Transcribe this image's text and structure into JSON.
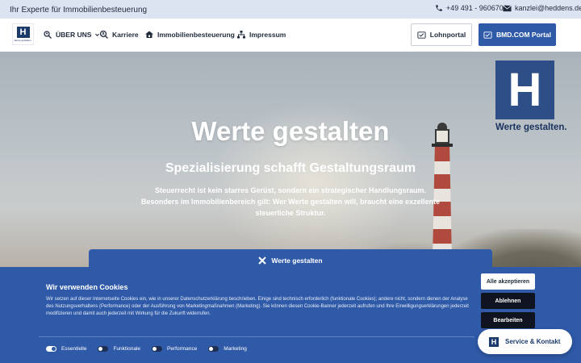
{
  "topbar": {
    "tagline": "Ihr Experte für Immobilienbesteuerung",
    "phone": "+49 491 - 9606700",
    "email": "kanzlei@heddens.de"
  },
  "header": {
    "logo_letter": "H",
    "logo_sub": "Werte gestalten.",
    "nav": {
      "ueber_uns": "ÜBER UNS",
      "karriere": "Karriere",
      "immobilienbesteuerung": "Immobilienbesteuerung",
      "impressum": "Impressum"
    },
    "lohnportal": "Lohnportal",
    "bmd_portal": "BMD.COM Portal"
  },
  "hero": {
    "brand_letter": "H",
    "brand_claim": "Werte gestalten.",
    "title": "Werte gestalten",
    "subtitle": "Spezialisierung schafft Gestaltungsraum",
    "text": "Steuerrecht ist kein starres Gerüst, sondern ein strategischer Handlungsraum. Besonders im Immobilienbereich gilt: Wer Werte gestalten will, braucht eine exzellente steuerliche Struktur."
  },
  "cookie": {
    "tab_label": "Werte gestalten",
    "title": "Wir verwenden Cookies",
    "text": "Wir setzen auf dieser Internetseite Cookies ein, wie in unserer Datenschutzerklärung beschrieben. Einige sind technisch erforderlich (funktionale Cookies); andere nicht, sondern dienen der Analyse des Nutzungsverhaltens (Performance) oder der Ausführung von Marketingmaßnahmen (Marketing). Sie können diesen Cookie-Banner jederzeit aufrufen und Ihre Einwilligungserklärungen jederzeit modifizieren und damit auch jederzeit mit Wirkung für die Zukunft widerrufen.",
    "accept_all": "Alle akzeptieren",
    "reject": "Ablehnen",
    "edit": "Bearbeiten",
    "toggles": {
      "essential": "Essentielle",
      "functional": "Funktionale",
      "performance": "Performance",
      "marketing": "Marketing"
    }
  },
  "service": {
    "label": "Service & Kontakt",
    "icon_letter": "H"
  },
  "colors": {
    "primary": "#2f5aa8",
    "brand_dark": "#1b3a6b",
    "topbar_bg": "#dde4f1"
  }
}
